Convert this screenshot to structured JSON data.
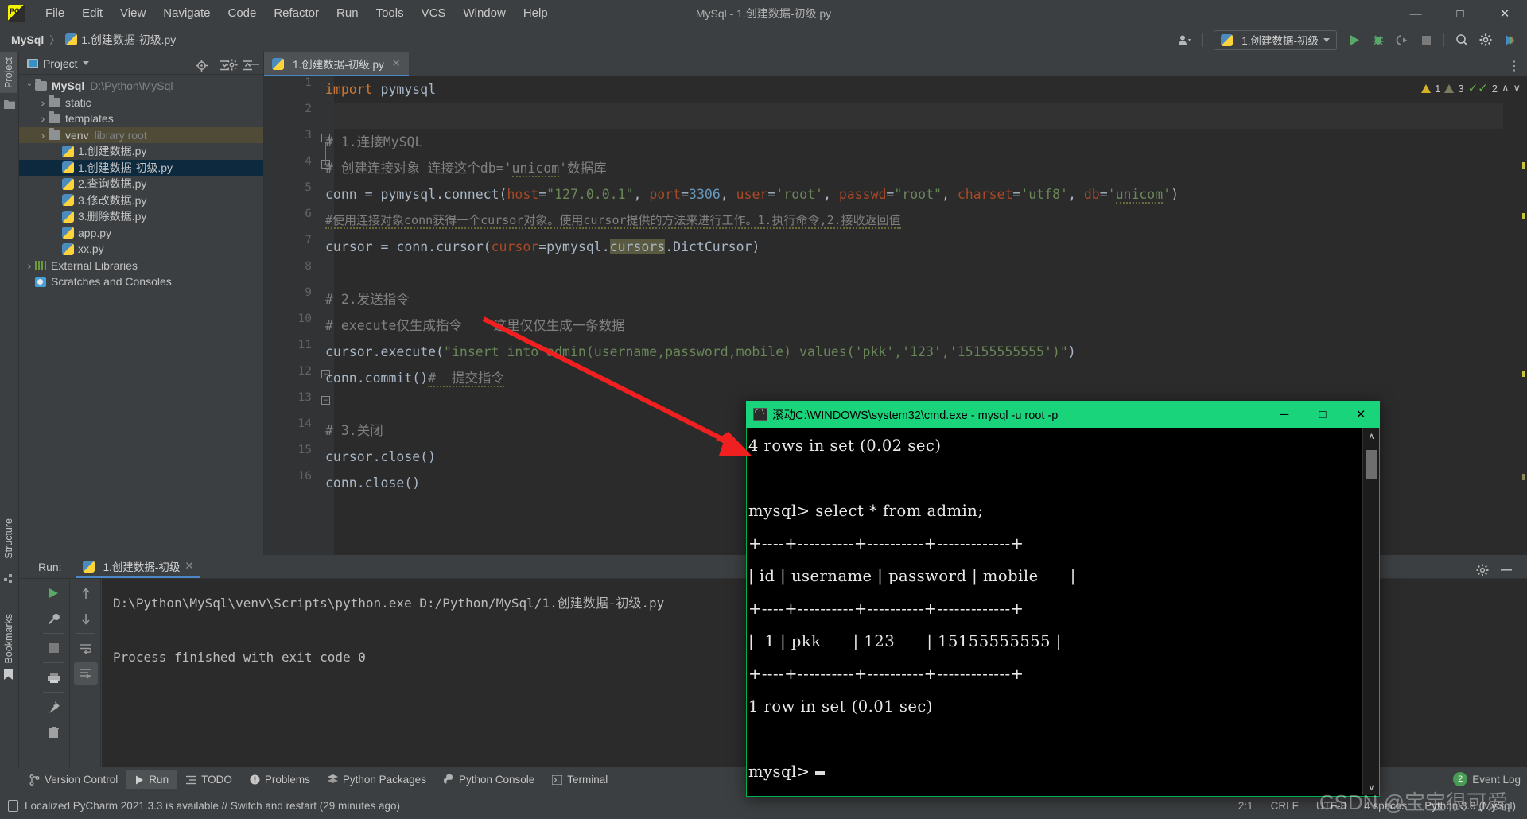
{
  "window": {
    "title": "MySql - 1.创建数据-初级.py",
    "minimize": "—",
    "maximize": "□",
    "close": "✕"
  },
  "menubar": {
    "items": [
      "File",
      "Edit",
      "View",
      "Navigate",
      "Code",
      "Refactor",
      "Run",
      "Tools",
      "VCS",
      "Window",
      "Help"
    ]
  },
  "breadcrumb": {
    "project": "MySql",
    "separator": "〉",
    "file": "1.创建数据-初级.py"
  },
  "toolbar": {
    "run_config": "1.创建数据-初级",
    "run_icon": "run-icon",
    "debug_icon": "debug-icon",
    "coverage_icon": "run-coverage-icon",
    "stop_icon": "stop-icon",
    "search_icon": "search-everywhere-icon",
    "settings_icon": "settings-icon",
    "updates_icon": "updates-icon",
    "account_icon": "account-icon"
  },
  "left_strip": {
    "project_tab": "Project",
    "structure_tab": "Structure",
    "bookmarks_tab": "Bookmarks"
  },
  "project_panel": {
    "title": "Project",
    "tools": [
      "select-opened-file-icon",
      "expand-all-icon",
      "collapse-all-icon",
      "settings-icon",
      "hide-icon"
    ],
    "tree": [
      {
        "indent": 0,
        "arrow": "down",
        "icon": "folder-icon",
        "label": "MySql",
        "bold": true,
        "dim": "D:\\Python\\MySql",
        "state": "normal"
      },
      {
        "indent": 1,
        "arrow": "right",
        "icon": "folder-icon",
        "label": "static",
        "bold": false,
        "dim": "",
        "state": "normal"
      },
      {
        "indent": 1,
        "arrow": "right",
        "icon": "folder-icon",
        "label": "templates",
        "bold": false,
        "dim": "",
        "state": "normal"
      },
      {
        "indent": 1,
        "arrow": "right",
        "icon": "folder-icon",
        "label": "venv",
        "bold": false,
        "dim": "library root",
        "state": "venv"
      },
      {
        "indent": 2,
        "arrow": "",
        "icon": "python-file-icon",
        "label": "1.创建数据.py",
        "bold": false,
        "dim": "",
        "state": "normal"
      },
      {
        "indent": 2,
        "arrow": "",
        "icon": "python-file-icon",
        "label": "1.创建数据-初级.py",
        "bold": false,
        "dim": "",
        "state": "selected"
      },
      {
        "indent": 2,
        "arrow": "",
        "icon": "python-file-icon",
        "label": "2.查询数据.py",
        "bold": false,
        "dim": "",
        "state": "normal"
      },
      {
        "indent": 2,
        "arrow": "",
        "icon": "python-file-icon",
        "label": "3.修改数据.py",
        "bold": false,
        "dim": "",
        "state": "normal"
      },
      {
        "indent": 2,
        "arrow": "",
        "icon": "python-file-icon",
        "label": "3.删除数据.py",
        "bold": false,
        "dim": "",
        "state": "normal"
      },
      {
        "indent": 2,
        "arrow": "",
        "icon": "python-file-icon",
        "label": "app.py",
        "bold": false,
        "dim": "",
        "state": "normal"
      },
      {
        "indent": 2,
        "arrow": "",
        "icon": "python-file-icon",
        "label": "xx.py",
        "bold": false,
        "dim": "",
        "state": "normal"
      },
      {
        "indent": 0,
        "arrow": "right",
        "icon": "external-libraries-icon",
        "label": "External Libraries",
        "bold": false,
        "dim": "",
        "state": "normal"
      },
      {
        "indent": 0,
        "arrow": "",
        "icon": "scratches-icon",
        "label": "Scratches and Consoles",
        "bold": false,
        "dim": "",
        "state": "normal"
      }
    ]
  },
  "editor": {
    "tab_label": "1.创建数据-初级.py",
    "tab_close": "✕",
    "inspection": {
      "warnings": "1",
      "weak_warnings": "3",
      "checks": "2",
      "up": "∧",
      "down": "∨"
    },
    "lines": [
      {
        "n": "1",
        "text": "import pymysql"
      },
      {
        "n": "2",
        "text": ""
      },
      {
        "n": "3",
        "text": "# 1.连接MySQL"
      },
      {
        "n": "4",
        "text": "# 创建连接对象 连接这个db='unicom'数据库"
      },
      {
        "n": "5",
        "text": "conn = pymysql.connect(host=\"127.0.0.1\", port=3306, user='root', passwd=\"root\", charset='utf8', db='unicom')"
      },
      {
        "n": "6",
        "text": "#使用连接对象conn获得一个cursor对象。使用cursor提供的方法来进行工作。1.执行命令,2.接收返回值"
      },
      {
        "n": "7",
        "text": "cursor = conn.cursor(cursor=pymysql.cursors.DictCursor)"
      },
      {
        "n": "8",
        "text": ""
      },
      {
        "n": "9",
        "text": "# 2.发送指令"
      },
      {
        "n": "10",
        "text": "# execute仅生成指令    这里仅仅生成一条数据"
      },
      {
        "n": "11",
        "text": "cursor.execute(\"insert into admin(username,password,mobile) values('pkk','123','15155555555')\")"
      },
      {
        "n": "12",
        "text": "conn.commit()# 提交指令"
      },
      {
        "n": "13",
        "text": ""
      },
      {
        "n": "14",
        "text": "# 3.关闭"
      },
      {
        "n": "15",
        "text": "cursor.close()"
      },
      {
        "n": "16",
        "text": "conn.close()"
      }
    ]
  },
  "run_panel": {
    "label": "Run:",
    "tab": "1.创建数据-初级",
    "tab_close": "✕",
    "console_line1": "D:\\Python\\MySql\\venv\\Scripts\\python.exe D:/Python/MySql/1.创建数据-初级.py",
    "console_line2": "Process finished with exit code 0",
    "tools": [
      "rerun-icon",
      "settings-icon",
      "stop-icon",
      "print-icon",
      "pin-icon",
      "trash-icon"
    ],
    "nav": [
      "scroll-up-icon",
      "scroll-down-icon",
      "soft-wrap-icon",
      "scroll-to-end-icon"
    ],
    "gear_icon": "gear-icon",
    "hide_icon": "hide-icon"
  },
  "cmd": {
    "title": "滚动C:\\WINDOWS\\system32\\cmd.exe - mysql  -u root -p",
    "minimize": "─",
    "maximize": "□",
    "close": "✕",
    "lines": [
      "4 rows in set (0.02 sec)",
      "",
      "mysql> select * from admin;",
      "+----+----------+----------+-------------+",
      "| id | username | password | mobile      |",
      "+----+----------+----------+-------------+",
      "|  1 | pkk      | 123      | 15155555555 |",
      "+----+----------+----------+-------------+",
      "1 row in set (0.01 sec)",
      "",
      "mysql> "
    ],
    "scroll_up": "∧",
    "scroll_down": "∨"
  },
  "bottom_tools": [
    {
      "label": "Version Control",
      "icon": "branch-icon",
      "active": false
    },
    {
      "label": "Run",
      "icon": "run-icon",
      "active": true
    },
    {
      "label": "TODO",
      "icon": "todo-icon",
      "active": false
    },
    {
      "label": "Problems",
      "icon": "problems-icon",
      "active": false
    },
    {
      "label": "Python Packages",
      "icon": "packages-icon",
      "active": false
    },
    {
      "label": "Python Console",
      "icon": "python-icon",
      "active": false
    },
    {
      "label": "Terminal",
      "icon": "terminal-icon",
      "active": false
    }
  ],
  "event_log": {
    "count": "2",
    "label": "Event Log"
  },
  "statusbar": {
    "message": "Localized PyCharm 2021.3.3 is available // Switch and restart (29 minutes ago)",
    "caret": "2:1",
    "line_sep": "CRLF",
    "encoding": "UTF-8",
    "indent": "4 spaces",
    "interpreter": "Python 3.9 (MySql)"
  },
  "watermark": "CSDN @宝宝很可爱",
  "colors": {
    "accent_blue": "#4a88c7",
    "cmd_title_green": "#1ad47c",
    "selection_blue": "#0d293e",
    "venv_highlight": "#4f4b36",
    "arrow_red": "#f02020",
    "editor_bg": "#2b2b2b",
    "panel_bg": "#3c3f41"
  }
}
